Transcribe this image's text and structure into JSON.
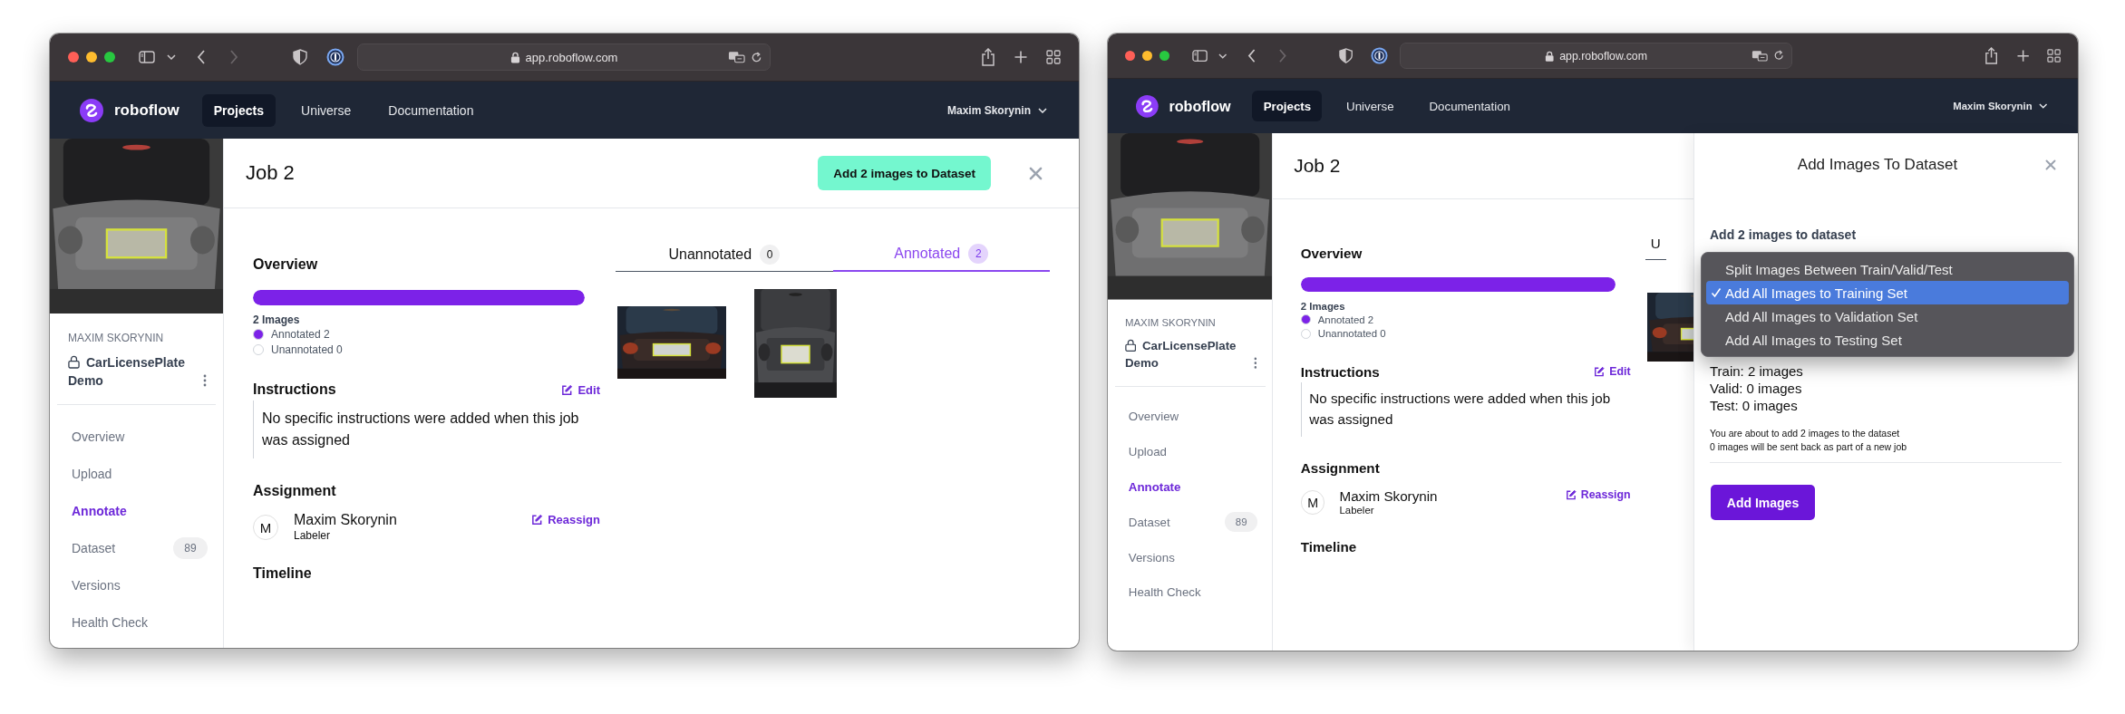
{
  "windows": [
    {
      "browser": {
        "url": "app.roboflow.com"
      },
      "nav": {
        "brand": "roboflow",
        "links": [
          {
            "label": "Projects",
            "selected": true
          },
          {
            "label": "Universe",
            "selected": false
          },
          {
            "label": "Documentation",
            "selected": false
          }
        ],
        "user": "Maxim Skorynin"
      },
      "sidebar": {
        "cover": {
          "kind": "picture"
        },
        "owner": "MAXIM SKORYNIN",
        "project": "CarLicensePlate Demo",
        "items": [
          {
            "label": "Overview",
            "selected": false
          },
          {
            "label": "Upload",
            "selected": false
          },
          {
            "label": "Annotate",
            "selected": true
          },
          {
            "label": "Dataset",
            "selected": false,
            "count": "89"
          },
          {
            "label": "Versions",
            "selected": false
          },
          {
            "label": "Health Check",
            "selected": false
          }
        ]
      },
      "header": {
        "title": "Job 2",
        "action_button": "Add 2 images to Dataset"
      },
      "overview": {
        "heading": "Overview",
        "level": 1,
        "total": "2 Images",
        "legend": [
          {
            "label": "Annotated 2",
            "color": "#7c22e8"
          },
          {
            "label": "Unannotated 0",
            "color": "#ffffff"
          }
        ]
      },
      "instructions": {
        "heading": "Instructions",
        "edit_link": "Edit",
        "text": "No specific instructions were added when this job was assigned"
      },
      "assignment": {
        "heading": "Assignment",
        "avatar": "M",
        "name": "Maxim Skorynin",
        "role": "Labeler",
        "reassign_link": "Reassign"
      },
      "timeline": {
        "heading": "Timeline"
      },
      "tabs": [
        {
          "label": "Unannotated",
          "count": "0",
          "selected": false
        },
        {
          "label": "Annotated",
          "count": "2",
          "selected": true
        }
      ],
      "thumbnails": [
        {
          "kind": "picture"
        },
        {
          "kind": "picture"
        }
      ]
    },
    {
      "browser": {
        "url": "app.roboflow.com"
      },
      "nav": {
        "brand": "roboflow",
        "links": [
          {
            "label": "Projects",
            "selected": true
          },
          {
            "label": "Universe",
            "selected": false
          },
          {
            "label": "Documentation",
            "selected": false
          }
        ],
        "user": "Maxim Skorynin"
      },
      "sidebar": {
        "cover": {
          "kind": "picture"
        },
        "owner": "MAXIM SKORYNIN",
        "project": "CarLicensePlate Demo",
        "items": [
          {
            "label": "Overview",
            "selected": false
          },
          {
            "label": "Upload",
            "selected": false
          },
          {
            "label": "Annotate",
            "selected": true
          },
          {
            "label": "Dataset",
            "selected": false,
            "count": "89"
          },
          {
            "label": "Versions",
            "selected": false
          },
          {
            "label": "Health Check",
            "selected": false
          }
        ]
      },
      "header": {
        "title": "Job 2"
      },
      "overview": {
        "heading": "Overview",
        "level": 1,
        "total": "2 Images",
        "legend": [
          {
            "label": "Annotated 2",
            "color": "#7c22e8"
          },
          {
            "label": "Unannotated 0",
            "color": "#ffffff"
          }
        ]
      },
      "instructions": {
        "heading": "Instructions",
        "edit_link": "Edit",
        "text": "No specific instructions were added when this job was assigned"
      },
      "assignment": {
        "heading": "Assignment",
        "avatar": "M",
        "name": "Maxim Skorynin",
        "role": "Labeler",
        "reassign_link": "Reassign"
      },
      "timeline": {
        "heading": "Timeline"
      },
      "tabs": [
        {
          "label": "U",
          "selected": false
        }
      ],
      "thumbnails": [
        {
          "kind": "picture"
        }
      ],
      "panel": {
        "title": "Add Images To Dataset",
        "label": "Add 2 images to dataset",
        "menu": [
          {
            "label": "Split Images Between Train/Valid/Test",
            "selected": false
          },
          {
            "label": "Add All Images to Training Set",
            "selected": true
          },
          {
            "label": "Add All Images to Validation Set",
            "selected": false
          },
          {
            "label": "Add All Images to Testing Set",
            "selected": false
          }
        ],
        "distribution": [
          "Train: 2 images",
          "Valid: 0 images",
          "Test: 0 images"
        ],
        "notes": [
          "You are about to add 2 images to the dataset",
          "0 images will be sent back as part of a new job"
        ],
        "button": "Add Images"
      }
    }
  ]
}
